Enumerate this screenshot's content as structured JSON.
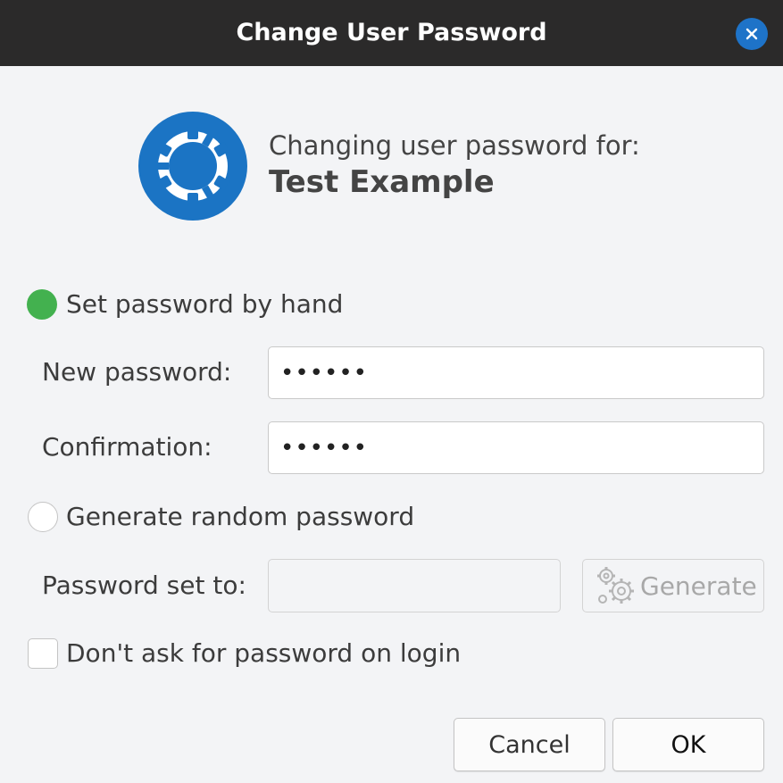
{
  "window": {
    "title": "Change User Password"
  },
  "header": {
    "heading": "Changing user password for:",
    "user_name": "Test Example"
  },
  "options": {
    "manual": {
      "label": "Set password by hand",
      "selected": true
    },
    "random": {
      "label": "Generate random password",
      "selected": false
    }
  },
  "fields": {
    "new_password": {
      "label": "New password:",
      "value": "••••••"
    },
    "confirmation": {
      "label": "Confirmation:",
      "value": "••••••"
    },
    "password_set_to": {
      "label": "Password set to:",
      "value": ""
    }
  },
  "generate_button": {
    "label": "Generate"
  },
  "no_password_login": {
    "label": "Don't ask for password on login",
    "checked": false
  },
  "buttons": {
    "cancel": "Cancel",
    "ok": "OK"
  },
  "colors": {
    "titlebar": "#2b2a2a",
    "accent_blue": "#1e73c8",
    "radio_selected": "#43b14f",
    "background": "#f3f4f6"
  },
  "icons": {
    "close": "close-icon",
    "logo": "kubuntu-logo-icon",
    "generate": "gears-icon"
  }
}
